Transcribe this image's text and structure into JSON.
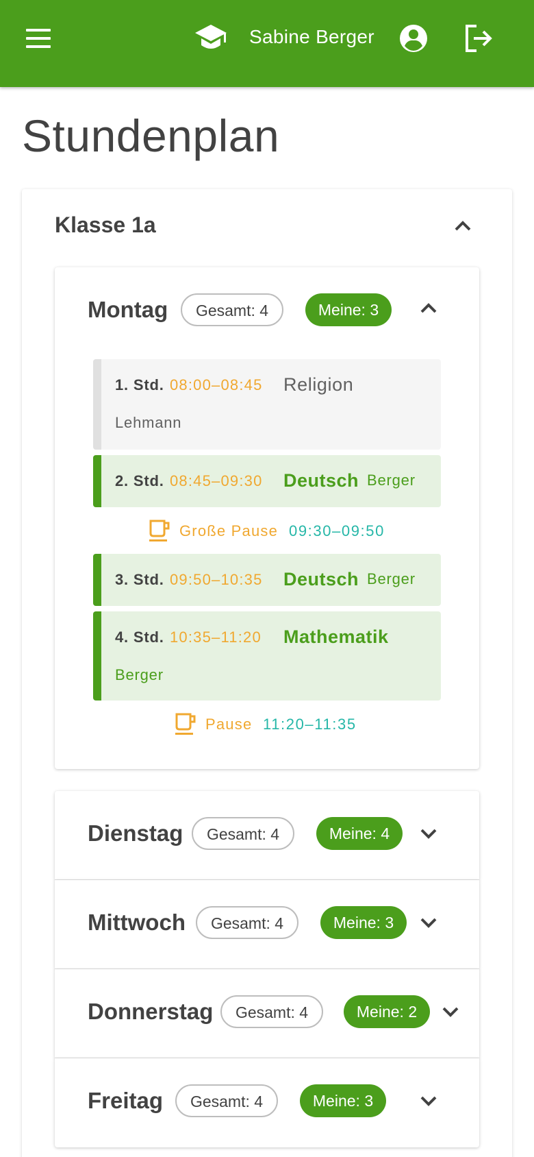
{
  "header": {
    "user_name": "Sabine Berger",
    "icons": [
      "menu-icon",
      "graduation-cap-icon",
      "account-circle-icon",
      "logout-icon"
    ],
    "background_color": "#4b9e1c"
  },
  "page": {
    "title": "Stundenplan"
  },
  "class_section": {
    "title": "Klasse 1a",
    "expanded": true
  },
  "days": [
    {
      "name": "Montag",
      "total": "Gesamt: 4",
      "mine": "Meine: 3",
      "expanded": true,
      "lessons": [
        {
          "number": "1. Std.",
          "time": "08:00–08:45",
          "subject": "Religion",
          "teacher": "Lehmann",
          "mine": false
        },
        {
          "number": "2. Std.",
          "time": "08:45–09:30",
          "subject": "Deutsch",
          "teacher": "Berger",
          "mine": true
        },
        {
          "number": "3. Std.",
          "time": "09:50–10:35",
          "subject": "Deutsch",
          "teacher": "Berger",
          "mine": true
        },
        {
          "number": "4. Std.",
          "time": "10:35–11:20",
          "subject": "Mathematik",
          "teacher": "Berger",
          "mine": true
        }
      ],
      "breaks": [
        {
          "label": "Große Pause",
          "time": "09:30–09:50"
        },
        {
          "label": "Pause",
          "time": "11:20–11:35"
        }
      ]
    },
    {
      "name": "Dienstag",
      "total": "Gesamt: 4",
      "mine": "Meine: 4",
      "expanded": false
    },
    {
      "name": "Mittwoch",
      "total": "Gesamt: 4",
      "mine": "Meine: 3",
      "expanded": false
    },
    {
      "name": "Donnerstag",
      "total": "Gesamt: 4",
      "mine": "Meine: 2",
      "expanded": false
    },
    {
      "name": "Freitag",
      "total": "Gesamt: 4",
      "mine": "Meine: 3",
      "expanded": false
    }
  ],
  "colors": {
    "primary": "#4b9e1c",
    "time": "#f0a830",
    "break_time": "#26b7a8",
    "my_lesson_bg": "#e6f2e1",
    "other_lesson_bg": "#f5f5f5"
  }
}
